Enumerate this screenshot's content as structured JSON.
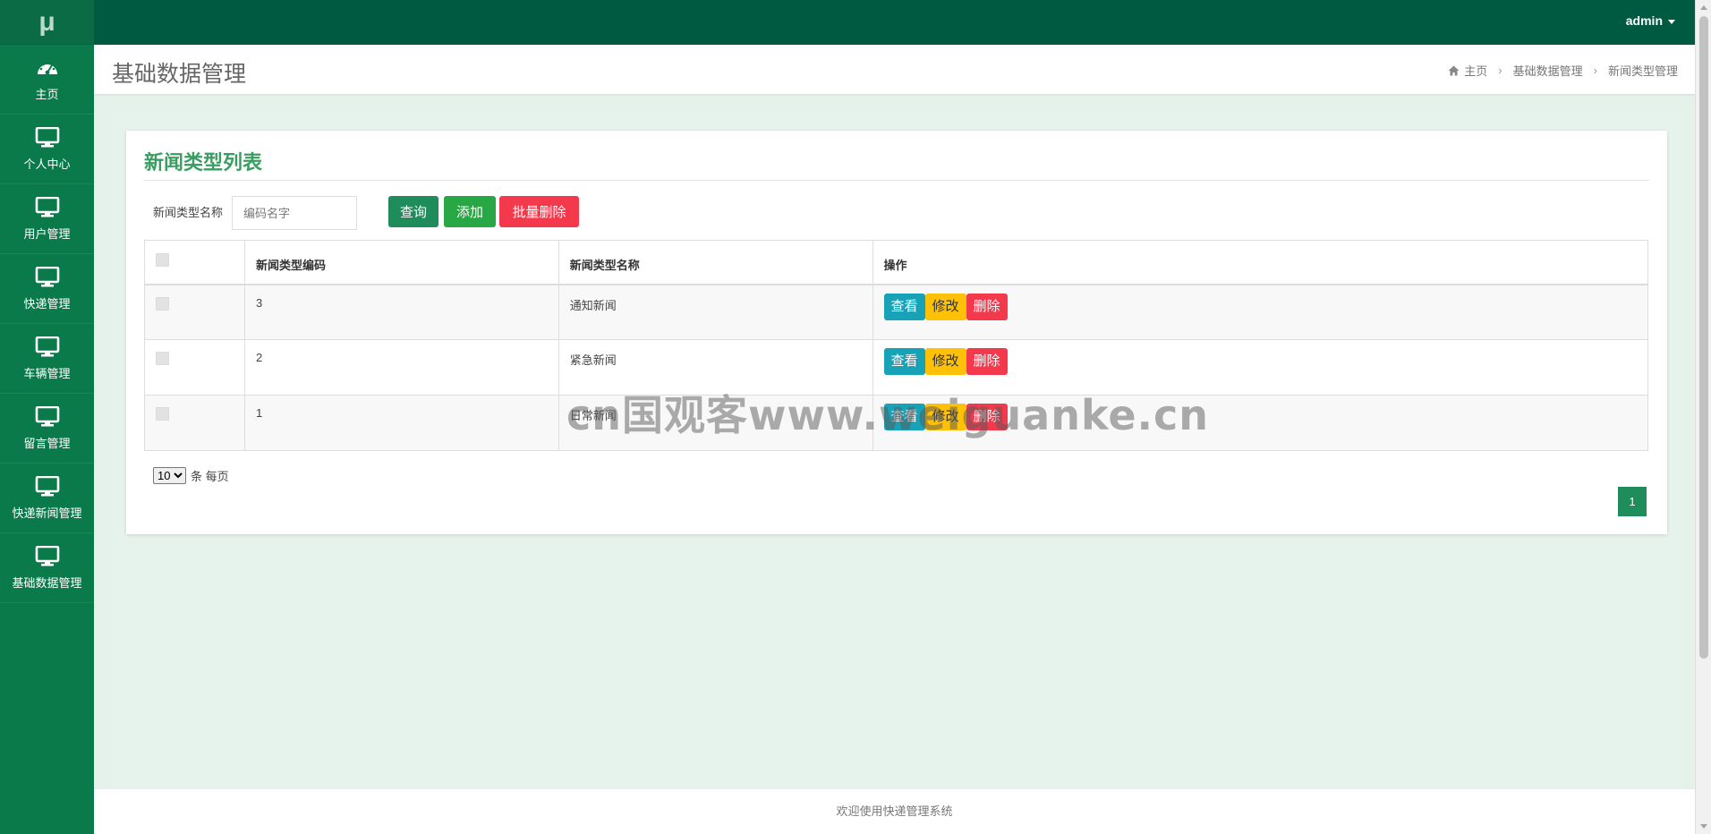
{
  "app": {
    "logo": "μ",
    "user": "admin"
  },
  "sidebar": {
    "items": [
      {
        "label": "主页",
        "icon": "dashboard-icon"
      },
      {
        "label": "个人中心",
        "icon": "monitor-icon"
      },
      {
        "label": "用户管理",
        "icon": "monitor-icon"
      },
      {
        "label": "快递管理",
        "icon": "monitor-icon"
      },
      {
        "label": "车辆管理",
        "icon": "monitor-icon"
      },
      {
        "label": "留言管理",
        "icon": "monitor-icon"
      },
      {
        "label": "快递新闻管理",
        "icon": "monitor-icon"
      },
      {
        "label": "基础数据管理",
        "icon": "monitor-icon"
      }
    ]
  },
  "header": {
    "title": "基础数据管理",
    "breadcrumb": [
      "主页",
      "基础数据管理",
      "新闻类型管理"
    ]
  },
  "main": {
    "card_title": "新闻类型列表",
    "search": {
      "label": "新闻类型名称",
      "placeholder": "编码名字",
      "value": ""
    },
    "buttons": {
      "query": "查询",
      "add": "添加",
      "batch_delete": "批量删除"
    },
    "table": {
      "columns": [
        "",
        "新闻类型编码",
        "新闻类型名称",
        "操作"
      ],
      "rows": [
        {
          "code": "3",
          "name": "通知新闻"
        },
        {
          "code": "2",
          "name": "紧急新闻"
        },
        {
          "code": "1",
          "name": "日常新闻"
        }
      ],
      "actions": {
        "view": "查看",
        "edit": "修改",
        "delete": "删除"
      }
    },
    "pagination": {
      "page_size": "10",
      "page_size_options": [
        "10"
      ],
      "page_size_suffix": "条 每页",
      "current_page": "1"
    }
  },
  "watermark": "cn国观客www.weiguanke.cn",
  "footer": "欢迎使用快递管理系统",
  "colors": {
    "sidebar": "#0b7a4b",
    "topbar": "#005a41",
    "accent": "#3a9e63",
    "view": "#17a2b8",
    "edit": "#ffc107",
    "delete": "#f5394d"
  }
}
